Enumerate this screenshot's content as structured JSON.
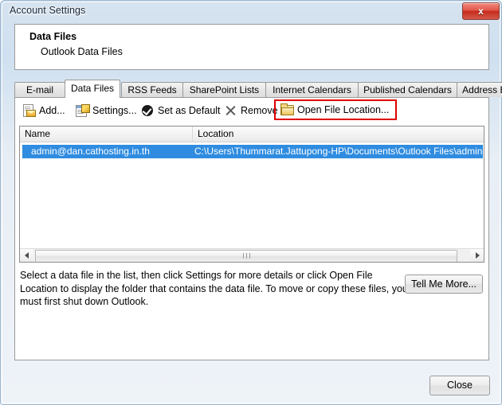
{
  "window": {
    "title": "Account Settings",
    "close_icon": "window-close-x"
  },
  "header": {
    "title": "Data Files",
    "subtitle": "Outlook Data Files"
  },
  "tabs": [
    {
      "label": "E-mail",
      "active": false
    },
    {
      "label": "Data Files",
      "active": true
    },
    {
      "label": "RSS Feeds",
      "active": false
    },
    {
      "label": "SharePoint Lists",
      "active": false
    },
    {
      "label": "Internet Calendars",
      "active": false
    },
    {
      "label": "Published Calendars",
      "active": false
    },
    {
      "label": "Address Books",
      "active": false
    }
  ],
  "toolbar": {
    "add_label": "Add...",
    "add_icon": "add-data-file-icon",
    "settings_label": "Settings...",
    "settings_icon": "settings-icon",
    "set_default_label": "Set as Default",
    "set_default_icon": "check-circle-icon",
    "remove_label": "Remove",
    "remove_icon": "x-icon",
    "open_location_label": "Open File Location...",
    "open_location_icon": "folder-icon",
    "highlight_color": "#e00000"
  },
  "list": {
    "columns": [
      "Name",
      "Location"
    ],
    "rows": [
      {
        "name": "admin@dan.cathosting.in.th",
        "location": "C:\\Users\\Thummarat.Jattupong-HP\\Documents\\Outlook Files\\admin@d",
        "selected": true
      }
    ],
    "selection_color": "#2f8ce0",
    "scrollbar": {
      "left_arrow_icon": "scroll-left-arrow-icon",
      "right_arrow_icon": "scroll-right-arrow-icon",
      "grip_icon": "scroll-thumb-grip-icon"
    }
  },
  "description": "Select a data file in the list, then click Settings for more details or click Open File Location to display the folder that contains the data file. To move or copy these files, you must first shut down Outlook.",
  "buttons": {
    "tell_me_more": "Tell Me More...",
    "close": "Close"
  }
}
